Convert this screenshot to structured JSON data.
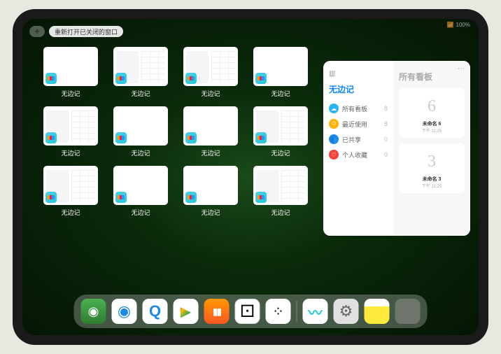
{
  "status": {
    "battery": "100%",
    "signal": "📶"
  },
  "top": {
    "add": "+",
    "reopen_label": "重新打开已关闭的窗口"
  },
  "app_label": "无边记",
  "thumbs": [
    {
      "variant": "blank"
    },
    {
      "variant": "grid"
    },
    {
      "variant": "grid"
    },
    {
      "variant": "blank"
    },
    {
      "variant": "grid"
    },
    {
      "variant": "blank"
    },
    {
      "variant": "blank"
    },
    {
      "variant": "grid"
    },
    {
      "variant": "grid"
    },
    {
      "variant": "blank"
    },
    {
      "variant": "blank"
    },
    {
      "variant": "grid"
    }
  ],
  "panel": {
    "left_title": "无边记",
    "right_title": "所有看板",
    "more": "⋯",
    "nav": [
      {
        "icon": "☁",
        "color": "#29b6f6",
        "label": "所有看板",
        "count": "8"
      },
      {
        "icon": "⏱",
        "color": "#ffb300",
        "label": "最近使用",
        "count": "8"
      },
      {
        "icon": "👥",
        "color": "#1e88e5",
        "label": "已共享",
        "count": "0"
      },
      {
        "icon": "♡",
        "color": "#f44336",
        "label": "个人收藏",
        "count": "0"
      }
    ],
    "boards": [
      {
        "sketch": "6",
        "name": "未命名 6",
        "sub": "下午 11:25"
      },
      {
        "sketch": "3",
        "name": "未命名 3",
        "sub": "下午 11:25"
      }
    ]
  },
  "dock": [
    {
      "name": "wechat"
    },
    {
      "name": "qq1"
    },
    {
      "name": "qq2"
    },
    {
      "name": "play"
    },
    {
      "name": "books"
    },
    {
      "name": "dice"
    },
    {
      "name": "dots"
    },
    {
      "sep": true
    },
    {
      "name": "freeform"
    },
    {
      "name": "settings"
    },
    {
      "name": "notes"
    },
    {
      "name": "stack"
    }
  ]
}
